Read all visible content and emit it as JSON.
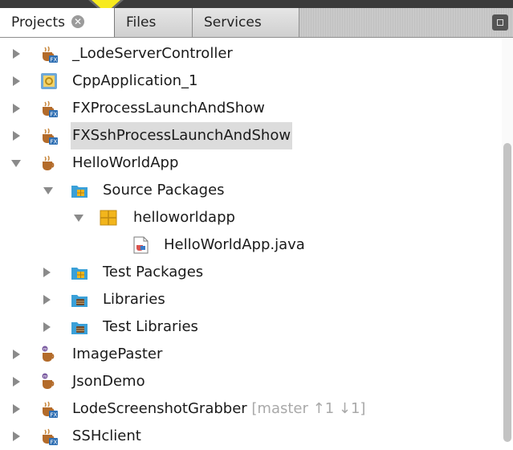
{
  "tabs": [
    {
      "label": "Projects",
      "active": true,
      "closable": true
    },
    {
      "label": "Files",
      "active": false
    },
    {
      "label": "Services",
      "active": false
    }
  ],
  "tree": [
    {
      "label": "_LodeServerController",
      "expanded": false,
      "icon": "javafx-project-icon"
    },
    {
      "label": "CppApplication_1",
      "expanded": false,
      "icon": "cpp-project-icon"
    },
    {
      "label": "FXProcessLaunchAndShow",
      "expanded": false,
      "icon": "javafx-project-icon"
    },
    {
      "label": "FXSshProcessLaunchAndShow",
      "expanded": false,
      "icon": "javafx-project-icon",
      "selected": true
    },
    {
      "label": "HelloWorldApp",
      "expanded": true,
      "icon": "java-project-icon"
    },
    {
      "label": "Source Packages",
      "expanded": true,
      "icon": "source-folder-icon"
    },
    {
      "label": "helloworldapp",
      "expanded": true,
      "icon": "package-icon"
    },
    {
      "label": "HelloWorldApp.java",
      "icon": "java-file-icon"
    },
    {
      "label": "Test Packages",
      "expanded": false,
      "icon": "source-folder-icon"
    },
    {
      "label": "Libraries",
      "expanded": false,
      "icon": "library-icon"
    },
    {
      "label": "Test Libraries",
      "expanded": false,
      "icon": "library-icon"
    },
    {
      "label": "ImagePaster",
      "expanded": false,
      "icon": "maven-project-icon"
    },
    {
      "label": "JsonDemo",
      "expanded": false,
      "icon": "maven-project-icon"
    },
    {
      "label": "LodeScreenshotGrabber",
      "extra": "[master ↑1 ↓1]",
      "expanded": false,
      "icon": "javafx-project-icon"
    },
    {
      "label": "SSHclient",
      "expanded": false,
      "icon": "javafx-project-icon"
    }
  ],
  "colors": {
    "callout": "#f7ea1f",
    "selection": "#dcdcdc",
    "folder": "#3aa0d8",
    "package": "#f2b51c"
  }
}
